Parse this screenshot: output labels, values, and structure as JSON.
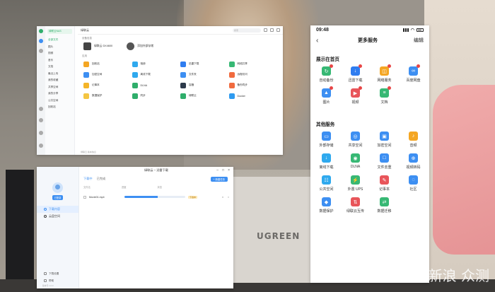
{
  "nas_window": {
    "device_name": "绿联云NAS",
    "sidebar_items": [
      "全部文件",
      "图片",
      "视频",
      "音乐",
      "文档",
      "最近上传",
      "我的收藏",
      "共享空间",
      "我的分享",
      "公共空间",
      "回收站"
    ],
    "app_title": "绿联云",
    "search_placeholder": "搜索",
    "hero_section": "设备信息",
    "hero": [
      {
        "label": "绿联云 DX4600",
        "sub": "已连接",
        "icon": "nas-device-icon"
      },
      {
        "label": "添加外部存储",
        "sub": "",
        "icon": "add-storage-icon"
      }
    ],
    "apps_section": "应用",
    "apps": [
      {
        "label": "回收站",
        "color": "#f4a623"
      },
      {
        "label": "相册",
        "color": "#2fa9ee"
      },
      {
        "label": "迅雷下载",
        "color": "#2f7df0"
      },
      {
        "label": "网络共享",
        "color": "#37b874"
      },
      {
        "label": "加密空间",
        "color": "#3d8ff2"
      },
      {
        "label": "离线下载",
        "color": "#2fa9ee"
      },
      {
        "label": "文件夹",
        "color": "#3d8ff2"
      },
      {
        "label": "远程访问",
        "color": "#f06b3f"
      },
      {
        "label": "记事本",
        "color": "#f4b428"
      },
      {
        "label": "DLNA",
        "color": "#2fae6b"
      },
      {
        "label": "容器",
        "color": "#2d3a4b"
      },
      {
        "label": "备份同步",
        "color": "#f06b3f"
      },
      {
        "label": "数据保护",
        "color": "#f4c542"
      },
      {
        "label": "同步",
        "color": "#2fae6b"
      },
      {
        "label": "绿联云",
        "color": "#2fae6b"
      },
      {
        "label": "Docker",
        "color": "#2f9bf0"
      }
    ],
    "footer": "绿联云 版本信息"
  },
  "download_window": {
    "title": "绿联云 – 迅雷下载",
    "user_badge": "已登录",
    "nav": [
      {
        "label": "下载内容",
        "active": true
      },
      {
        "label": "云盘空间",
        "active": false
      }
    ],
    "bottom_nav": [
      "下载设置",
      "帮助"
    ],
    "version": "版本号 1.0.0",
    "tabs": [
      {
        "label": "下载中",
        "active": true
      },
      {
        "label": "已完成",
        "active": false
      }
    ],
    "new_button": "+ 新建任务",
    "columns": [
      "文件名",
      "进度",
      "状态"
    ],
    "rows": [
      {
        "filename": "Movie01.mp4",
        "progress": 0.55,
        "badge": "下载中"
      }
    ]
  },
  "phone": {
    "time": "09:48",
    "title": "更多服务",
    "edit": "编辑",
    "pinned_section": "展示在首页",
    "pinned": [
      {
        "label": "自动备份",
        "color": "#37b874",
        "glyph": "↻"
      },
      {
        "label": "迅雷下载",
        "color": "#2f7df0",
        "glyph": "↓"
      },
      {
        "label": "网络服务",
        "color": "#f4a623",
        "glyph": "◫"
      },
      {
        "label": "百度网盘",
        "color": "#3d8ff2",
        "glyph": "∞"
      },
      {
        "label": "图片",
        "color": "#3d8ff2",
        "glyph": "▲"
      },
      {
        "label": "视频",
        "color": "#e8555a",
        "glyph": "▶"
      },
      {
        "label": "文档",
        "color": "#37b874",
        "glyph": "≡"
      }
    ],
    "other_section": "其他服务",
    "others": [
      {
        "label": "外部存储",
        "color": "#3d8ff2",
        "glyph": "▭"
      },
      {
        "label": "共享空间",
        "color": "#3d8ff2",
        "glyph": "◎"
      },
      {
        "label": "加密空间",
        "color": "#3d8ff2",
        "glyph": "▣"
      },
      {
        "label": "音频",
        "color": "#f4a623",
        "glyph": "♪"
      },
      {
        "label": "离线下载",
        "color": "#2fa9ee",
        "glyph": "↓"
      },
      {
        "label": "DLNA",
        "color": "#37b874",
        "glyph": "◉"
      },
      {
        "label": "文件去重",
        "color": "#3d8ff2",
        "glyph": "□"
      },
      {
        "label": "视频转码",
        "color": "#3d8ff2",
        "glyph": "⊕"
      },
      {
        "label": "公共空间",
        "color": "#2fa9ee",
        "glyph": "☷"
      },
      {
        "label": "外置 UPS",
        "color": "#37b874",
        "glyph": "⚡"
      },
      {
        "label": "记事本",
        "color": "#e8555a",
        "glyph": "✎"
      },
      {
        "label": "社区",
        "color": "#3d8ff2",
        "glyph": "◌"
      },
      {
        "label": "数据保护",
        "color": "#3d8ff2",
        "glyph": "◆"
      },
      {
        "label": "绿联云互传",
        "color": "#e8555a",
        "glyph": "⇅"
      },
      {
        "label": "数据迁移",
        "color": "#37b874",
        "glyph": "⇄"
      }
    ]
  },
  "photo": {
    "nas_brand": "UGREEN",
    "watermark": "新浪 众测"
  }
}
